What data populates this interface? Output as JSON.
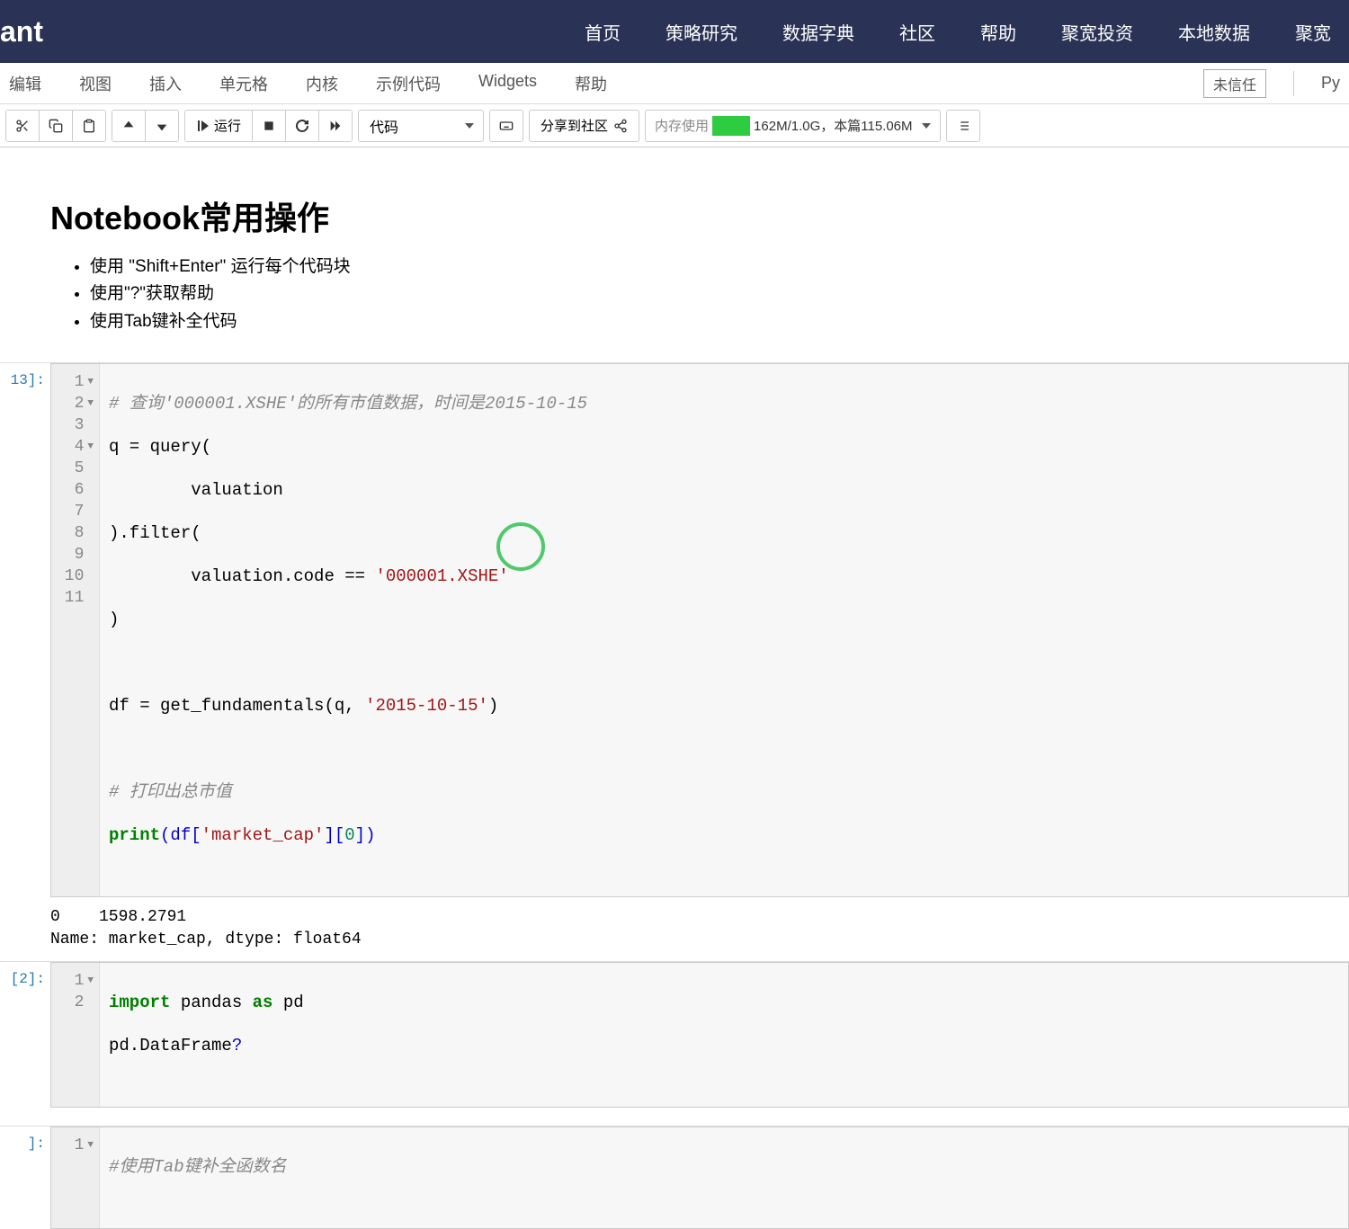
{
  "topnav": {
    "logo": "ant",
    "links": [
      "首页",
      "策略研究",
      "数据字典",
      "社区",
      "帮助",
      "聚宽投资",
      "本地数据",
      "聚宽"
    ]
  },
  "menubar": {
    "items": [
      "编辑",
      "视图",
      "插入",
      "单元格",
      "内核",
      "示例代码",
      "Widgets",
      "帮助"
    ],
    "trust": "未信任",
    "kernel": "Py"
  },
  "toolbar": {
    "run_label": "运行",
    "cell_type": "代码",
    "share_label": "分享到社区",
    "mem_label": "内存使用",
    "mem_text": "162M/1.0G，本篇115.06M"
  },
  "markdown": {
    "heading": "Notebook常用操作",
    "items": [
      "使用 \"Shift+Enter\" 运行每个代码块",
      "使用\"?\"获取帮助",
      "使用Tab键补全代码"
    ]
  },
  "cell1": {
    "prompt": "13]:",
    "lines": {
      "l1a": "# 查询'000001.XSHE'的所有市值数据，时间是2015-10-15",
      "l2a": "q = query(",
      "l3a": "        valuation",
      "l4a": ").filter(",
      "l5a": "        valuation.code == ",
      "l5b": "'000001.XSHE'",
      "l6a": ")",
      "l8a": "df = get_fundamentals(q, ",
      "l8b": "'2015-10-15'",
      "l8c": ")",
      "l10a": "# 打印出总市值",
      "l11a": "print",
      "l11b": "(df[",
      "l11c": "'market_cap'",
      "l11d": "][",
      "l11e": "0",
      "l11f": "])"
    },
    "output": "0    1598.2791\nName: market_cap, dtype: float64"
  },
  "cell2": {
    "prompt": "[2]:",
    "lines": {
      "l1a": "import",
      "l1b": " pandas ",
      "l1c": "as",
      "l1d": " pd",
      "l2a": "pd.DataFrame",
      "l2b": "?"
    }
  },
  "cell3": {
    "prompt": "]:",
    "lines": {
      "l1a": "#使用Tab键补全函数名"
    }
  }
}
